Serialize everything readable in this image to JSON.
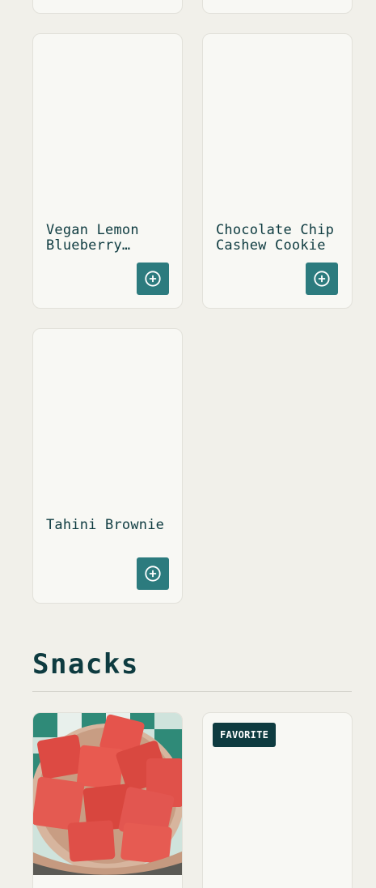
{
  "products": [
    {
      "title": "Vegan Lemon Blueberry…",
      "add_icon": "plus-circle-icon"
    },
    {
      "title": "Chocolate Chip Cashew Cookie",
      "add_icon": "plus-circle-icon"
    },
    {
      "title": "Tahini Brownie",
      "add_icon": "plus-circle-icon"
    }
  ],
  "section": {
    "title": "Snacks"
  },
  "snacks": [
    {
      "image": "watermelon-cubes-in-bowl"
    },
    {
      "badge": "FAVORITE"
    }
  ],
  "colors": {
    "background": "#f1f0ea",
    "card": "#f8f8f4",
    "accent": "#2c7b7e",
    "text": "#0e3b40",
    "badge": "#0e3b40"
  }
}
